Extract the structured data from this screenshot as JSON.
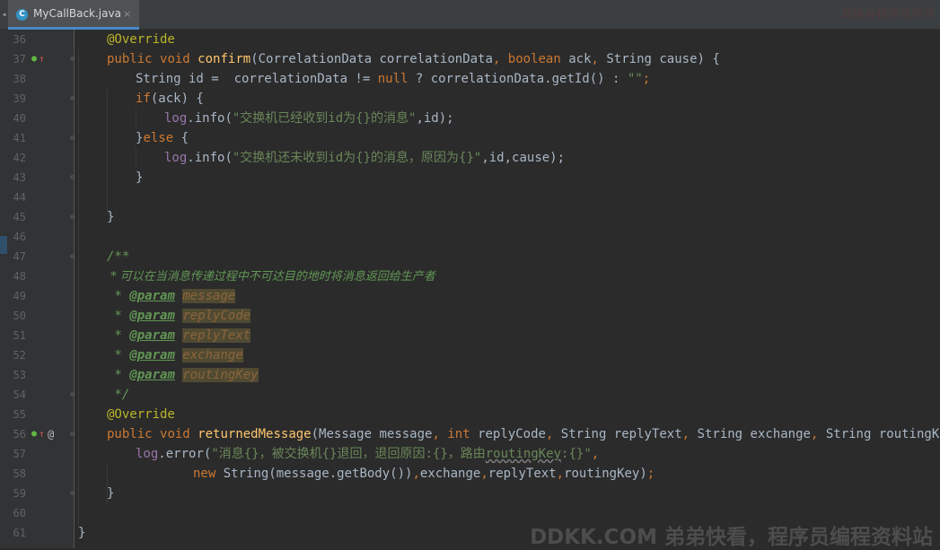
{
  "tab": {
    "filename": "MyCallBack.java",
    "close_glyph": "×",
    "icon_letter": "C",
    "scroll_glyph": "◂",
    "right_hint": "尚硅谷程序员学习"
  },
  "gutter": {
    "line_numbers": [
      "36",
      "37",
      "38",
      "39",
      "40",
      "41",
      "42",
      "43",
      "44",
      "45",
      "46",
      "47",
      "48",
      "49",
      "50",
      "51",
      "52",
      "53",
      "54",
      "55",
      "56",
      "57",
      "58",
      "59",
      "60",
      "61"
    ],
    "impl_glyph": "●",
    "up_glyph": "↑",
    "override_glyph": "@",
    "fold_glyph": "⊖"
  },
  "code": {
    "l36": {
      "ann": "@Override"
    },
    "l37": {
      "kw1": "public",
      "kw2": "void",
      "fn": "confirm",
      "p1": "(CorrelationData correlationData",
      "c1": ",",
      "kw3": "boolean",
      "p2": " ack",
      "c2": ",",
      "p3": " String cause) {"
    },
    "l38": {
      "a": "String id =  correlationData != ",
      "kw": "null",
      "b": " ? correlationData.getId() : ",
      "s": "\"\"",
      "e": ";"
    },
    "l39": {
      "kw": "if",
      "a": "(ack) {"
    },
    "l40": {
      "f": "log",
      "a": ".info(",
      "s": "\"交换机已经收到id为{}的消息\"",
      "b": ",id);"
    },
    "l41": {
      "a": "}",
      "kw": "else",
      "b": " {"
    },
    "l42": {
      "f": "log",
      "a": ".info(",
      "s": "\"交换机还未收到id为{}的消息，原因为{}\"",
      "b": ",id,cause);"
    },
    "l43": {
      "a": "}"
    },
    "l45": {
      "a": "}"
    },
    "l47": {
      "c": "/**"
    },
    "l48": {
      "c": " * 可以在当消息传递过程中不可达目的地时将消息返回给生产者"
    },
    "l49": {
      "star": " * ",
      "tag": "@param",
      "sp": " ",
      "pm": "message"
    },
    "l50": {
      "star": " * ",
      "tag": "@param",
      "sp": " ",
      "pm": "replyCode"
    },
    "l51": {
      "star": " * ",
      "tag": "@param",
      "sp": " ",
      "pm": "replyText"
    },
    "l52": {
      "star": " * ",
      "tag": "@param",
      "sp": " ",
      "pm": "exchange"
    },
    "l53": {
      "star": " * ",
      "tag": "@param",
      "sp": " ",
      "pm": "routingKey"
    },
    "l54": {
      "c": " */"
    },
    "l55": {
      "ann": "@Override"
    },
    "l56": {
      "kw1": "public",
      "kw2": "void",
      "fn": "returnedMessage",
      "p1": "(Message message",
      "c1": ",",
      "kw3": "int",
      "p2": " replyCode",
      "c2": ",",
      "p3": " String replyText",
      "c3": ",",
      "p4": " String exchange",
      "c4": ",",
      "p5": " String routingKey) {"
    },
    "l57": {
      "f": "log",
      "a": ".error(",
      "s1": "\"消息{}，被交换机{}退回，退回原因:{}，路由",
      "sq": "routingKey",
      "s2": ":{}\"",
      "c": ","
    },
    "l58": {
      "kw": "new",
      "a": " String(message.getBody())",
      "c1": ",",
      "b": "exchange",
      "c2": ",",
      "d": "replyText",
      "c3": ",",
      "e": "routingKey)",
      "c4": ";"
    },
    "l59": {
      "a": "}"
    },
    "l61": {
      "a": "}"
    }
  },
  "colors": {
    "background": "#2b2b2b",
    "keyword": "#cc7832",
    "annotation": "#bbb529",
    "method": "#ffc66d",
    "string": "#6a8759",
    "field": "#9876aa",
    "doc_comment": "#629755",
    "default_text": "#a9b7c6"
  },
  "watermark": {
    "text": "DDKK.COM 弟弟快看，程序员编程资料站"
  }
}
